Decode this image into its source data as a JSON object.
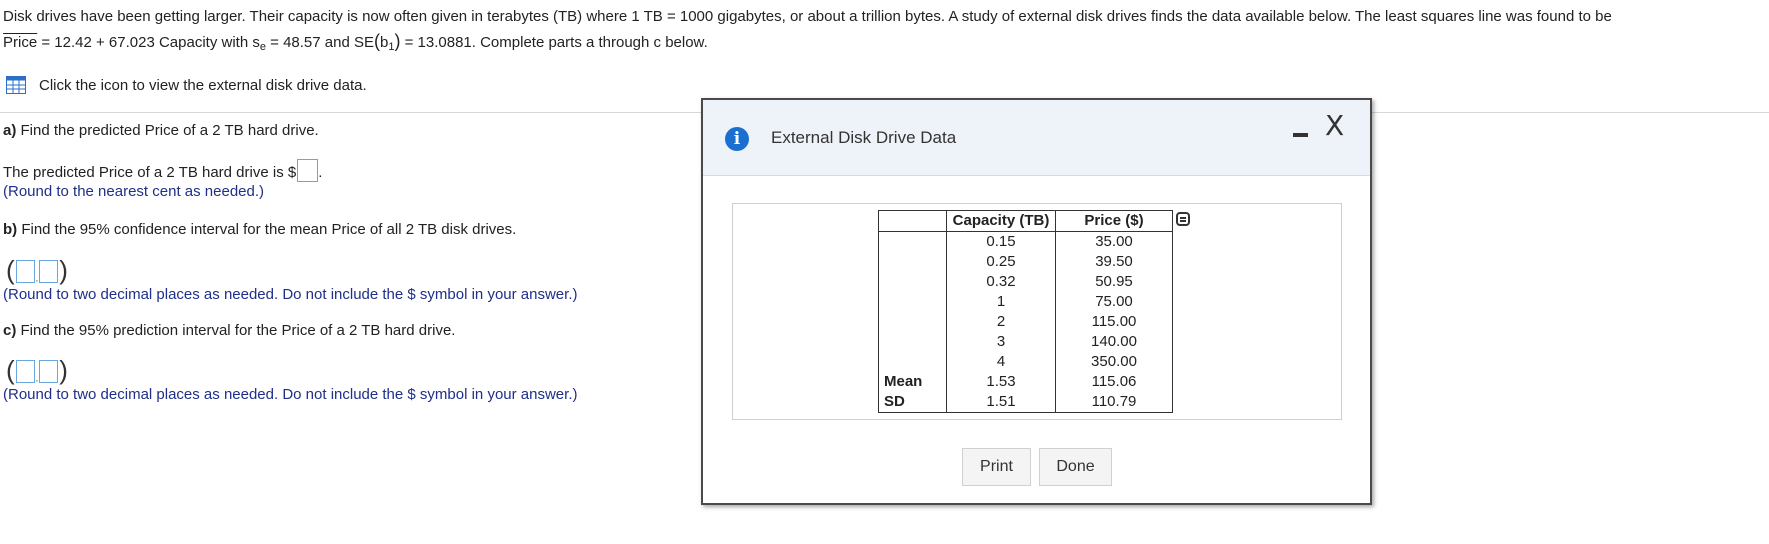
{
  "intro": {
    "line1": "Disk drives have been getting larger. Their capacity is now often given in terabytes (TB) where 1 TB = 1000 gigabytes, or about a trillion bytes. A study of external disk drives finds the data available below. The least squares line was found to be",
    "price_hat": "Price",
    "equation": " = 12.42 + 67.023 Capacity with s",
    "se_sub": "e",
    "se_val": " = 48.57 and SE",
    "b_letter": "b",
    "b_sub": "1",
    "se_b_val": " = 13.0881. Complete parts a through c below."
  },
  "data_link": {
    "label": "Click the icon to view the external disk drive data.",
    "icon": "grid-table-icon"
  },
  "part_a": {
    "label": "a)",
    "question": " Find the predicted Price of a 2 TB hard drive.",
    "answer_prefix": "The predicted Price of a 2 TB hard drive is $",
    "answer_suffix": ".",
    "hint": "(Round to the nearest cent as needed.)"
  },
  "part_b": {
    "label": "b)",
    "question": " Find the 95% confidence interval for the mean Price of all 2 TB disk drives.",
    "hint": "(Round to two decimal places as needed. Do not include the $ symbol in your answer.)"
  },
  "part_c": {
    "label": "c)",
    "question": " Find the 95% prediction interval for the Price of a 2 TB hard drive.",
    "hint": "(Round to two decimal places as needed. Do not include the $ symbol in your answer.)"
  },
  "interval_symbols": {
    "open": "(",
    "comma": ",",
    "close": ")"
  },
  "dialog": {
    "title": "External Disk Drive Data",
    "info_icon": "i",
    "close_icon": "X",
    "table": {
      "headers": [
        "Capacity (TB)",
        "Price ($)"
      ],
      "rows": [
        [
          "0.15",
          "35.00"
        ],
        [
          "0.25",
          "39.50"
        ],
        [
          "0.32",
          "50.95"
        ],
        [
          "1",
          "75.00"
        ],
        [
          "2",
          "115.00"
        ],
        [
          "3",
          "140.00"
        ],
        [
          "4",
          "350.00"
        ]
      ],
      "summary": [
        {
          "label": "Mean",
          "capacity": "1.53",
          "price": "115.06"
        },
        {
          "label": "SD",
          "capacity": "1.51",
          "price": "110.79"
        }
      ]
    },
    "print_label": "Print",
    "done_label": "Done"
  },
  "colors": {
    "hint": "#1f2f8a",
    "info": "#1a6fd0",
    "input_border": "#6aa6de",
    "dialog_header": "#eef3fa"
  }
}
